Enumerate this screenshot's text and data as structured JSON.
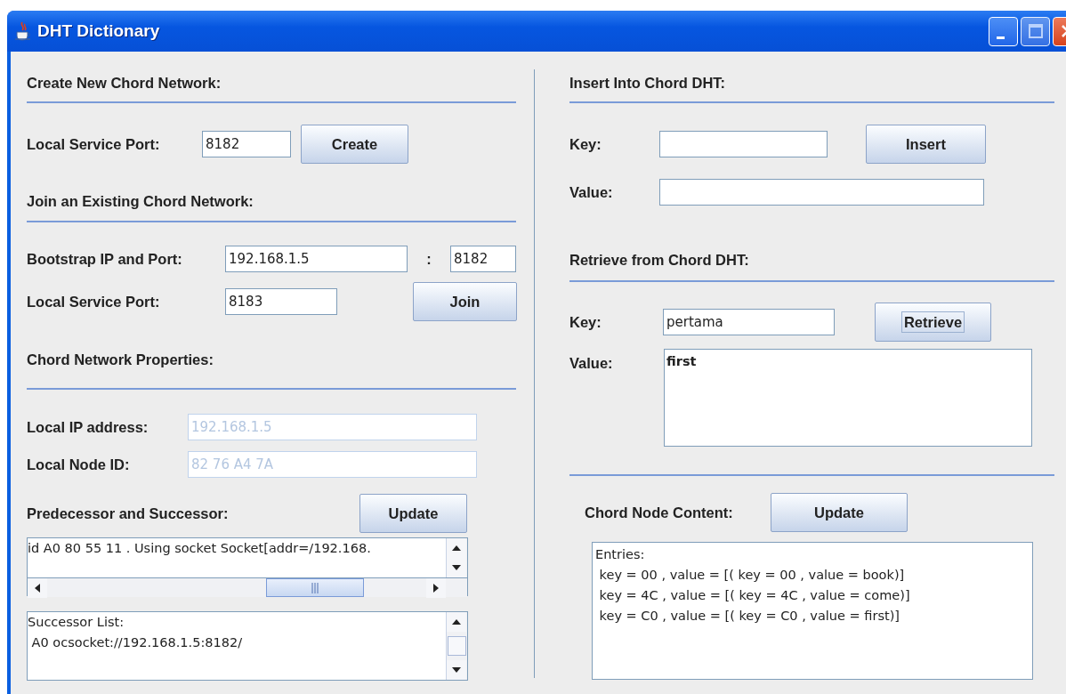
{
  "window": {
    "title": "DHT Dictionary"
  },
  "create_section": {
    "heading": "Create New Chord Network:",
    "port_label": "Local Service Port:",
    "port_value": "8182",
    "button": "Create"
  },
  "join_section": {
    "heading": "Join an Existing Chord Network:",
    "bootstrap_label": "Bootstrap IP and Port:",
    "ip_value": "192.168.1.5",
    "separator": ":",
    "port_value": "8182",
    "local_port_label": "Local Service Port:",
    "local_port_value": "8183",
    "button": "Join"
  },
  "properties_section": {
    "heading": "Chord Network Properties:",
    "fields": [
      {
        "label": "Local IP address:",
        "value": "192.168.1.5",
        "disabled": true
      },
      {
        "label": "Local Node ID:",
        "value": "82 76 A4 7A",
        "disabled": true
      }
    ],
    "neighbors_label": "Predecessor and Successor:",
    "button": "Update",
    "log_lines": [
      "id A0 80 55 11 . Using socket Socket[addr=/192.168."
    ],
    "successor_lines": [
      "Successor List:",
      " A0 ocsocket://192.168.1.5:8182/"
    ]
  },
  "insert_section": {
    "heading": "Insert Into Chord DHT:",
    "key_label": "Key:",
    "value_label": "Value:",
    "button": "Insert"
  },
  "retrieve_section": {
    "heading": "Retrieve from Chord DHT:",
    "key_label": "Key:",
    "key_value": "pertama",
    "button": "Retrieve",
    "button_focused": true,
    "value_label": "Value:",
    "value_lines": [
      "first"
    ]
  },
  "content_section": {
    "label": "Chord Node Content:",
    "button": "Update",
    "lines": [
      "Entries:",
      " key = 00 , value = [( key = 00 , value = book)]",
      " key = 4C , value = [( key = 4C , value = come)]",
      " key = C0 , value = [( key = C0 , value = first)]"
    ]
  }
}
